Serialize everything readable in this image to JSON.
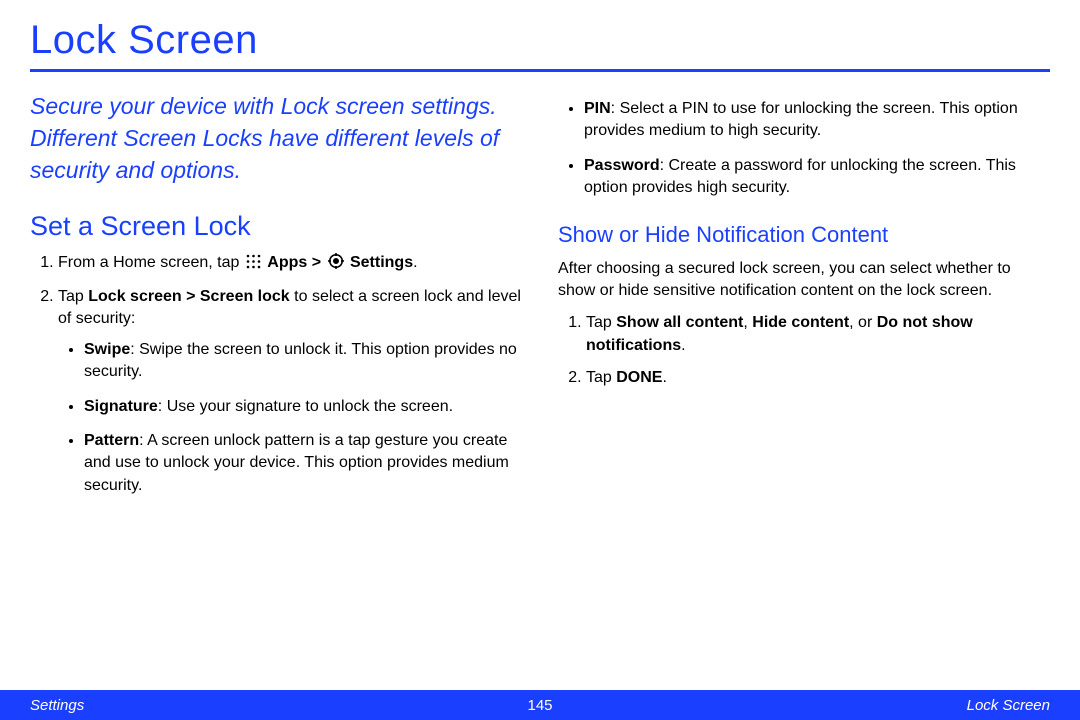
{
  "title": "Lock Screen",
  "intro": "Secure your device with Lock screen settings. Different Screen Locks have different levels of security and options.",
  "section1": {
    "heading": "Set a Screen Lock",
    "step1_pre": "From a Home screen, tap ",
    "step1_apps": "Apps > ",
    "step1_settings": "Settings",
    "step1_post": ".",
    "step2_pre": "Tap ",
    "step2_bold": "Lock screen > Screen lock",
    "step2_post": " to select a screen lock and level of security:",
    "bullets": {
      "b1_label": "Swipe",
      "b1_text": ": Swipe the screen to unlock it. This option provides no security.",
      "b2_label": "Signature",
      "b2_text": ": Use your signature to unlock the screen.",
      "b3_label": "Pattern",
      "b3_text": ": A screen unlock pattern is a tap gesture you create and use to unlock your device. This option provides medium security.",
      "b4_label": "PIN",
      "b4_text": ": Select a PIN to use for unlocking the screen. This option provides medium to high security.",
      "b5_label": "Password",
      "b5_text": ": Create a password for unlocking the screen. This option provides high security."
    }
  },
  "section2": {
    "heading": "Show or Hide Notification Content",
    "para": "After choosing a secured lock screen, you can select whether to show or hide sensitive notification content on the lock screen.",
    "s1_pre": "Tap ",
    "s1_b1": "Show all content",
    "s1_c1": ", ",
    "s1_b2": "Hide content",
    "s1_c2": ", or ",
    "s1_b3": "Do not show notifications",
    "s1_post": ".",
    "s2_pre": "Tap ",
    "s2_bold": "DONE",
    "s2_post": "."
  },
  "footer": {
    "left": "Settings",
    "center": "145",
    "right": "Lock Screen"
  }
}
